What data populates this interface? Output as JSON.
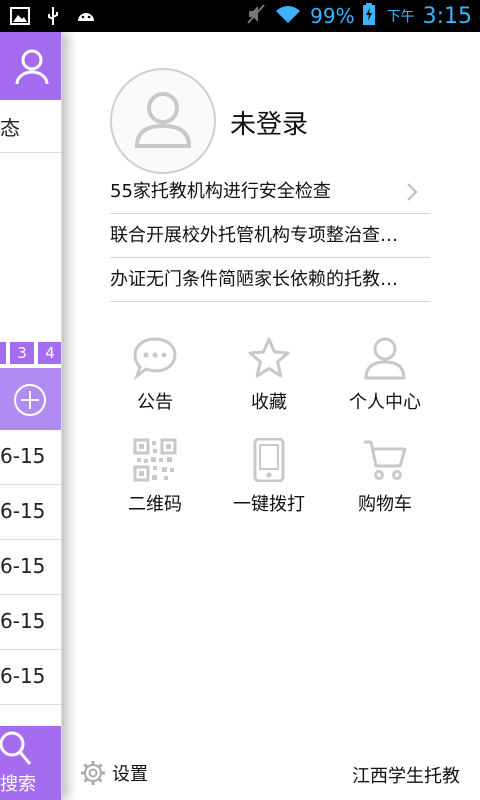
{
  "status_bar": {
    "battery": "99%",
    "time_prefix": "下午",
    "time": "3:15"
  },
  "left_panel": {
    "status_fragment": "态",
    "pages": [
      "",
      "3",
      "4"
    ],
    "dates": [
      "6-15",
      "6-15",
      "6-15",
      "6-15",
      "6-15"
    ],
    "search_label": "搜索"
  },
  "user": {
    "login_status": "未登录"
  },
  "news": [
    {
      "title": "55家托教机构进行安全检查"
    },
    {
      "title": "联合开展校外托管机构专项整治查出..."
    },
    {
      "title": "办证无门条件简陋家长依赖的托教中..."
    }
  ],
  "grid": [
    {
      "label": "公告",
      "icon": "chat-bubble-icon"
    },
    {
      "label": "收藏",
      "icon": "star-icon"
    },
    {
      "label": "个人中心",
      "icon": "user-icon"
    },
    {
      "label": "二维码",
      "icon": "qr-code-icon"
    },
    {
      "label": "一键拨打",
      "icon": "phone-icon"
    },
    {
      "label": "购物车",
      "icon": "cart-icon"
    }
  ],
  "footer": {
    "settings_label": "设置",
    "brand": "江西学生托教"
  },
  "colors": {
    "accent": "#a56cf0",
    "accent_light": "#b08cf2",
    "icon_gray": "#c8c8c8",
    "status_blue": "#3db3ff"
  }
}
